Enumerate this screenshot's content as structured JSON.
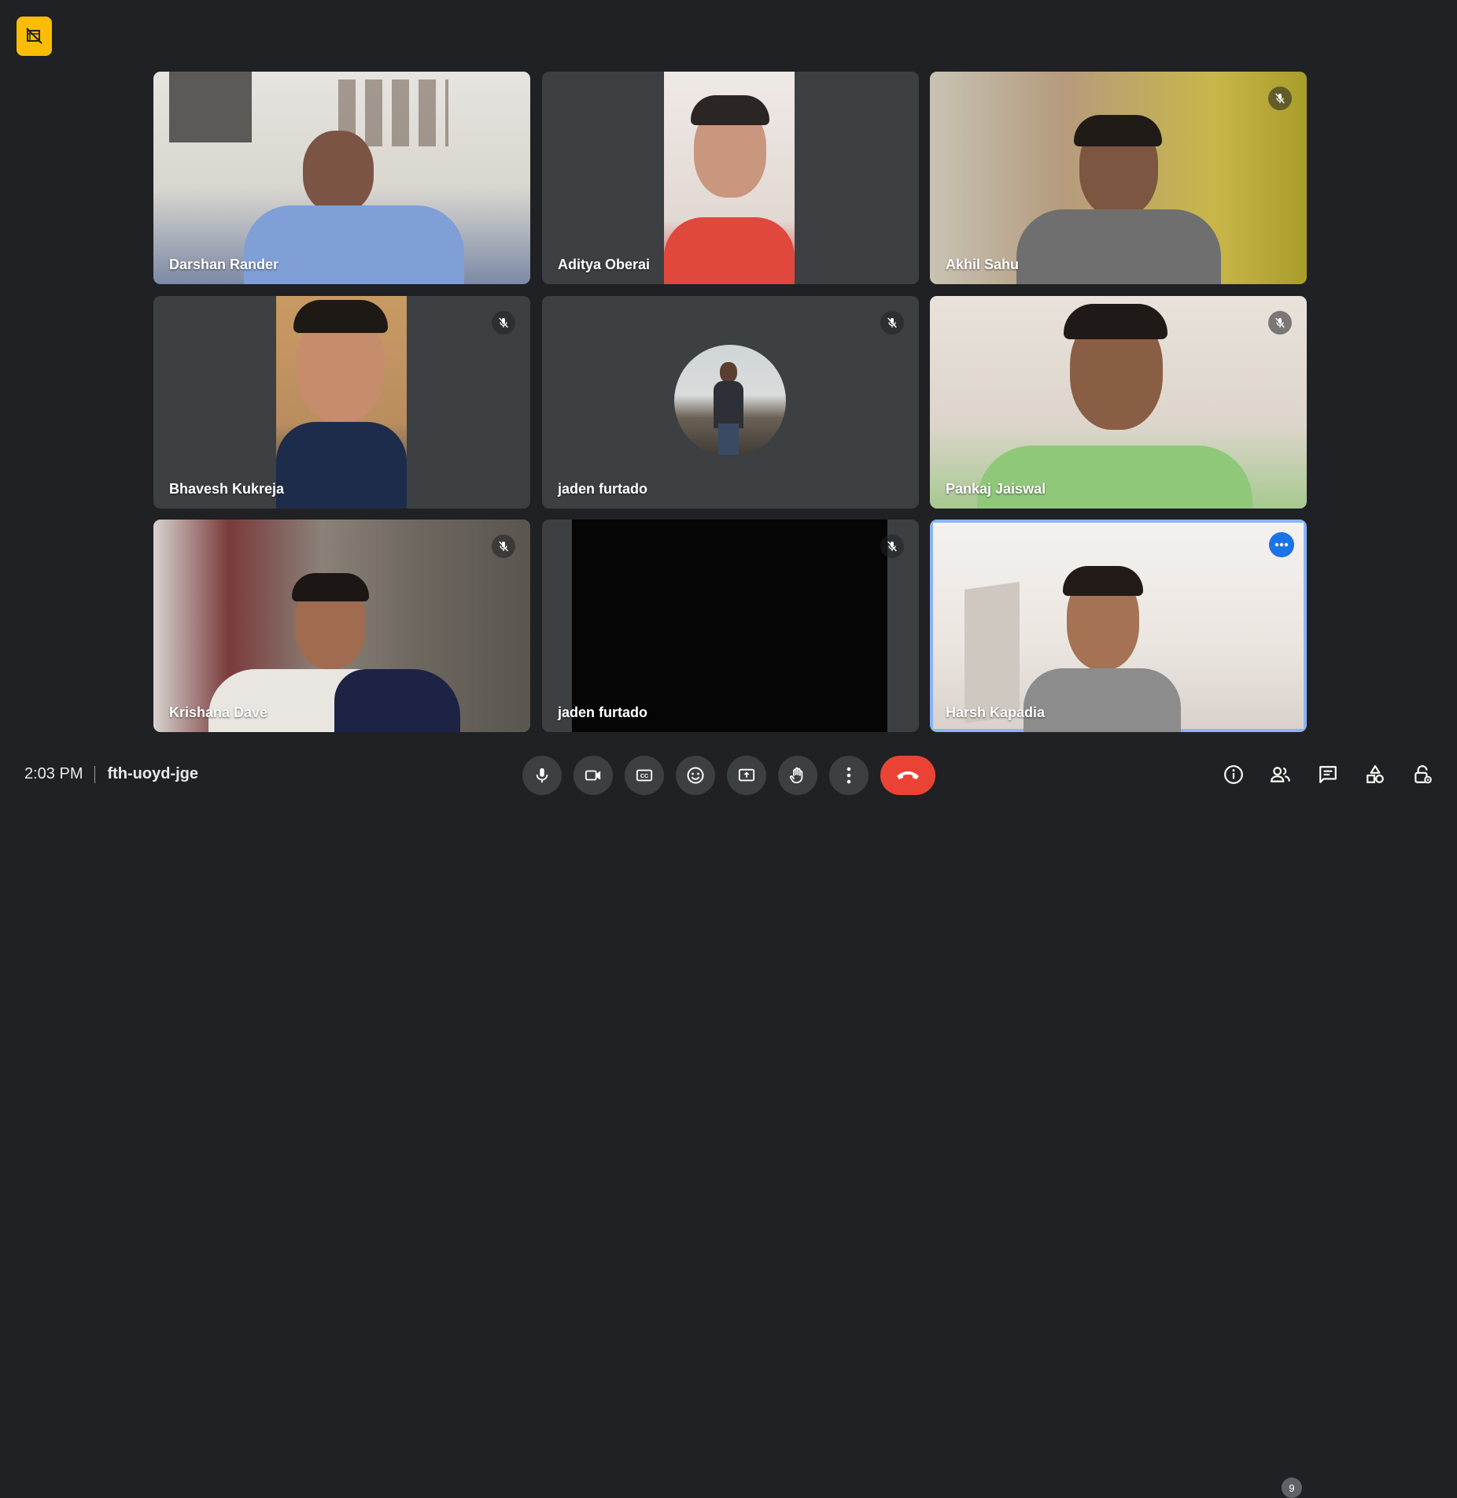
{
  "meeting": {
    "time": "2:03 PM",
    "code": "fth-uoyd-jge"
  },
  "participants": [
    {
      "name": "Darshan Rander",
      "muted": false
    },
    {
      "name": "Aditya Oberai",
      "muted": false
    },
    {
      "name": "Akhil Sahu",
      "muted": true
    },
    {
      "name": "Bhavesh Kukreja",
      "muted": true
    },
    {
      "name": "jaden furtado",
      "muted": true,
      "camera_off": true
    },
    {
      "name": "Pankaj Jaiswal",
      "muted": true
    },
    {
      "name": "Krishana Dave",
      "muted": true
    },
    {
      "name": "jaden furtado",
      "muted": true
    },
    {
      "name": "Harsh Kapadia",
      "muted": false,
      "active_speaker": true
    }
  ],
  "people_count": "9",
  "controls": [
    "mic-icon",
    "camera-icon",
    "captions-icon",
    "emoji-icon",
    "present-icon",
    "raise-hand-icon",
    "more-options-icon",
    "end-call-icon"
  ],
  "side_controls": [
    "info-icon",
    "people-icon",
    "chat-icon",
    "activities-icon",
    "host-controls-icon"
  ],
  "colors": {
    "background": "#202124",
    "tile": "#3c4043",
    "leave": "#ea4335",
    "recording": "#fbbc04",
    "active_border": "#8ab4f8"
  }
}
